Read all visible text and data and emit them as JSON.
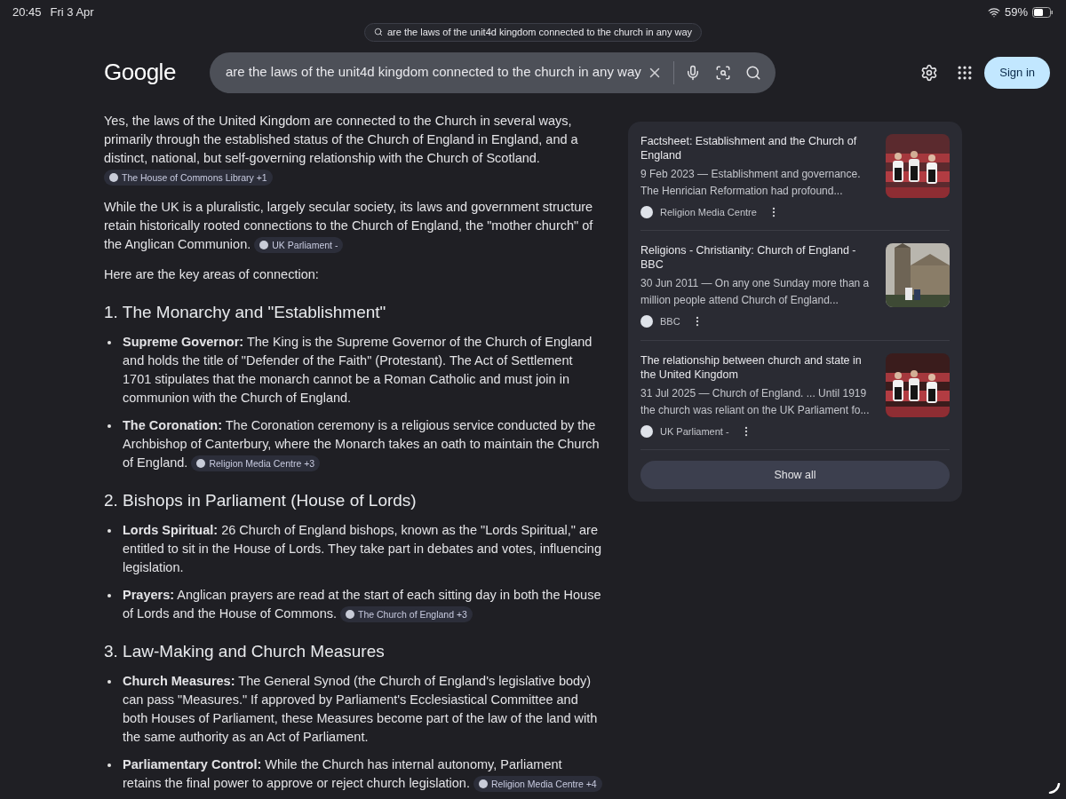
{
  "status_bar": {
    "time": "20:45",
    "date": "Fri 3 Apr",
    "battery": "59%"
  },
  "url_pill": {
    "text": "are the laws of the unit4d kingdom connected to the church in any way"
  },
  "header": {
    "logo": "Google",
    "search_value": "are the laws of the unit4d kingdom connected to the church in any way",
    "sign_in": "Sign in"
  },
  "answer": [
    {
      "kind": "paragraph",
      "text": "Yes, the laws of the United Kingdom are connected to the Church in several ways, primarily through the established status of the Church of England in England, and a distinct, national, but self-governing relationship with the Church of Scotland.",
      "citation": "The House of Commons Library +1"
    },
    {
      "kind": "paragraph",
      "text": "While the UK is a pluralistic, largely secular society, its laws and government structure retain historically rooted connections to the Church of England, the \"mother church\" of the Anglican Communion.",
      "citation": "UK Parliament -"
    },
    {
      "kind": "paragraph",
      "text": "Here are the key areas of connection:"
    },
    {
      "kind": "heading",
      "text": "1. The Monarchy and \"Establishment\""
    },
    {
      "kind": "bullets",
      "items": [
        {
          "text": "**Supreme Governor:** The King is the Supreme Governor of the Church of England and holds the title of \"Defender of the Faith\" (Protestant). The Act of Settlement 1701 stipulates that the monarch cannot be a Roman Catholic and must join in communion with the Church of England."
        },
        {
          "text": "**The Coronation:** The Coronation ceremony is a religious service conducted by the Archbishop of Canterbury, where the Monarch takes an oath to maintain the Church of England.",
          "citation": "Religion Media Centre +3"
        }
      ]
    },
    {
      "kind": "heading",
      "text": "2. Bishops in Parliament (House of Lords)"
    },
    {
      "kind": "bullets",
      "items": [
        {
          "text": "**Lords Spiritual:** 26 Church of England bishops, known as the \"Lords Spiritual,\" are entitled to sit in the House of Lords. They take part in debates and votes, influencing legislation."
        },
        {
          "text": "**Prayers:** Anglican prayers are read at the start of each sitting day in both the House of Lords and the House of Commons.",
          "citation": "The Church of England +3"
        }
      ]
    },
    {
      "kind": "heading",
      "text": "3. Law-Making and Church Measures"
    },
    {
      "kind": "bullets",
      "items": [
        {
          "text": "**Church Measures:** The General Synod (the Church of England's legislative body) can pass \"Measures.\" If approved by Parliament's Ecclesiastical Committee and both Houses of Parliament, these Measures become part of the law of the land with the same authority as an Act of Parliament."
        },
        {
          "text": "**Parliamentary Control:** While the Church has internal autonomy, Parliament retains the final power to approve or reject church legislation.",
          "citation": "Religion Media Centre +4"
        }
      ]
    }
  ],
  "sources": {
    "items": [
      {
        "title": "Factsheet: Establishment and the Church of England",
        "snippet": "9 Feb 2023 — Establishment and governance. The Henrician Reformation had profound...",
        "source": "Religion Media Centre"
      },
      {
        "title": "Religions - Christianity: Church of England - BBC",
        "snippet": "30 Jun 2011 — On any one Sunday more than a million people attend Church of England...",
        "source": "BBC"
      },
      {
        "title": "The relationship between church and state in the United Kingdom",
        "snippet": "31 Jul 2025 — Church of England. ... Until 1919 the church was reliant on the UK Parliament fo...",
        "source": "UK Parliament -"
      }
    ],
    "show_all": "Show all"
  }
}
